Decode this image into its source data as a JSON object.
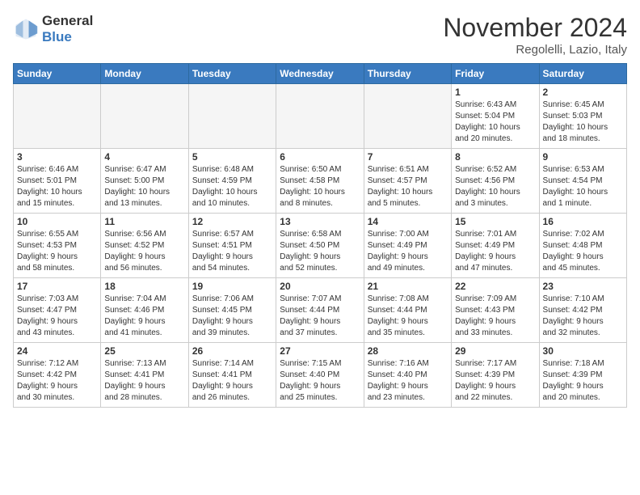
{
  "header": {
    "logo_line1": "General",
    "logo_line2": "Blue",
    "month": "November 2024",
    "location": "Regolelli, Lazio, Italy"
  },
  "weekdays": [
    "Sunday",
    "Monday",
    "Tuesday",
    "Wednesday",
    "Thursday",
    "Friday",
    "Saturday"
  ],
  "weeks": [
    [
      {
        "day": "",
        "info": "",
        "empty": true
      },
      {
        "day": "",
        "info": "",
        "empty": true
      },
      {
        "day": "",
        "info": "",
        "empty": true
      },
      {
        "day": "",
        "info": "",
        "empty": true
      },
      {
        "day": "",
        "info": "",
        "empty": true
      },
      {
        "day": "1",
        "info": "Sunrise: 6:43 AM\nSunset: 5:04 PM\nDaylight: 10 hours\nand 20 minutes.",
        "empty": false
      },
      {
        "day": "2",
        "info": "Sunrise: 6:45 AM\nSunset: 5:03 PM\nDaylight: 10 hours\nand 18 minutes.",
        "empty": false
      }
    ],
    [
      {
        "day": "3",
        "info": "Sunrise: 6:46 AM\nSunset: 5:01 PM\nDaylight: 10 hours\nand 15 minutes.",
        "empty": false
      },
      {
        "day": "4",
        "info": "Sunrise: 6:47 AM\nSunset: 5:00 PM\nDaylight: 10 hours\nand 13 minutes.",
        "empty": false
      },
      {
        "day": "5",
        "info": "Sunrise: 6:48 AM\nSunset: 4:59 PM\nDaylight: 10 hours\nand 10 minutes.",
        "empty": false
      },
      {
        "day": "6",
        "info": "Sunrise: 6:50 AM\nSunset: 4:58 PM\nDaylight: 10 hours\nand 8 minutes.",
        "empty": false
      },
      {
        "day": "7",
        "info": "Sunrise: 6:51 AM\nSunset: 4:57 PM\nDaylight: 10 hours\nand 5 minutes.",
        "empty": false
      },
      {
        "day": "8",
        "info": "Sunrise: 6:52 AM\nSunset: 4:56 PM\nDaylight: 10 hours\nand 3 minutes.",
        "empty": false
      },
      {
        "day": "9",
        "info": "Sunrise: 6:53 AM\nSunset: 4:54 PM\nDaylight: 10 hours\nand 1 minute.",
        "empty": false
      }
    ],
    [
      {
        "day": "10",
        "info": "Sunrise: 6:55 AM\nSunset: 4:53 PM\nDaylight: 9 hours\nand 58 minutes.",
        "empty": false
      },
      {
        "day": "11",
        "info": "Sunrise: 6:56 AM\nSunset: 4:52 PM\nDaylight: 9 hours\nand 56 minutes.",
        "empty": false
      },
      {
        "day": "12",
        "info": "Sunrise: 6:57 AM\nSunset: 4:51 PM\nDaylight: 9 hours\nand 54 minutes.",
        "empty": false
      },
      {
        "day": "13",
        "info": "Sunrise: 6:58 AM\nSunset: 4:50 PM\nDaylight: 9 hours\nand 52 minutes.",
        "empty": false
      },
      {
        "day": "14",
        "info": "Sunrise: 7:00 AM\nSunset: 4:49 PM\nDaylight: 9 hours\nand 49 minutes.",
        "empty": false
      },
      {
        "day": "15",
        "info": "Sunrise: 7:01 AM\nSunset: 4:49 PM\nDaylight: 9 hours\nand 47 minutes.",
        "empty": false
      },
      {
        "day": "16",
        "info": "Sunrise: 7:02 AM\nSunset: 4:48 PM\nDaylight: 9 hours\nand 45 minutes.",
        "empty": false
      }
    ],
    [
      {
        "day": "17",
        "info": "Sunrise: 7:03 AM\nSunset: 4:47 PM\nDaylight: 9 hours\nand 43 minutes.",
        "empty": false
      },
      {
        "day": "18",
        "info": "Sunrise: 7:04 AM\nSunset: 4:46 PM\nDaylight: 9 hours\nand 41 minutes.",
        "empty": false
      },
      {
        "day": "19",
        "info": "Sunrise: 7:06 AM\nSunset: 4:45 PM\nDaylight: 9 hours\nand 39 minutes.",
        "empty": false
      },
      {
        "day": "20",
        "info": "Sunrise: 7:07 AM\nSunset: 4:44 PM\nDaylight: 9 hours\nand 37 minutes.",
        "empty": false
      },
      {
        "day": "21",
        "info": "Sunrise: 7:08 AM\nSunset: 4:44 PM\nDaylight: 9 hours\nand 35 minutes.",
        "empty": false
      },
      {
        "day": "22",
        "info": "Sunrise: 7:09 AM\nSunset: 4:43 PM\nDaylight: 9 hours\nand 33 minutes.",
        "empty": false
      },
      {
        "day": "23",
        "info": "Sunrise: 7:10 AM\nSunset: 4:42 PM\nDaylight: 9 hours\nand 32 minutes.",
        "empty": false
      }
    ],
    [
      {
        "day": "24",
        "info": "Sunrise: 7:12 AM\nSunset: 4:42 PM\nDaylight: 9 hours\nand 30 minutes.",
        "empty": false
      },
      {
        "day": "25",
        "info": "Sunrise: 7:13 AM\nSunset: 4:41 PM\nDaylight: 9 hours\nand 28 minutes.",
        "empty": false
      },
      {
        "day": "26",
        "info": "Sunrise: 7:14 AM\nSunset: 4:41 PM\nDaylight: 9 hours\nand 26 minutes.",
        "empty": false
      },
      {
        "day": "27",
        "info": "Sunrise: 7:15 AM\nSunset: 4:40 PM\nDaylight: 9 hours\nand 25 minutes.",
        "empty": false
      },
      {
        "day": "28",
        "info": "Sunrise: 7:16 AM\nSunset: 4:40 PM\nDaylight: 9 hours\nand 23 minutes.",
        "empty": false
      },
      {
        "day": "29",
        "info": "Sunrise: 7:17 AM\nSunset: 4:39 PM\nDaylight: 9 hours\nand 22 minutes.",
        "empty": false
      },
      {
        "day": "30",
        "info": "Sunrise: 7:18 AM\nSunset: 4:39 PM\nDaylight: 9 hours\nand 20 minutes.",
        "empty": false
      }
    ]
  ]
}
